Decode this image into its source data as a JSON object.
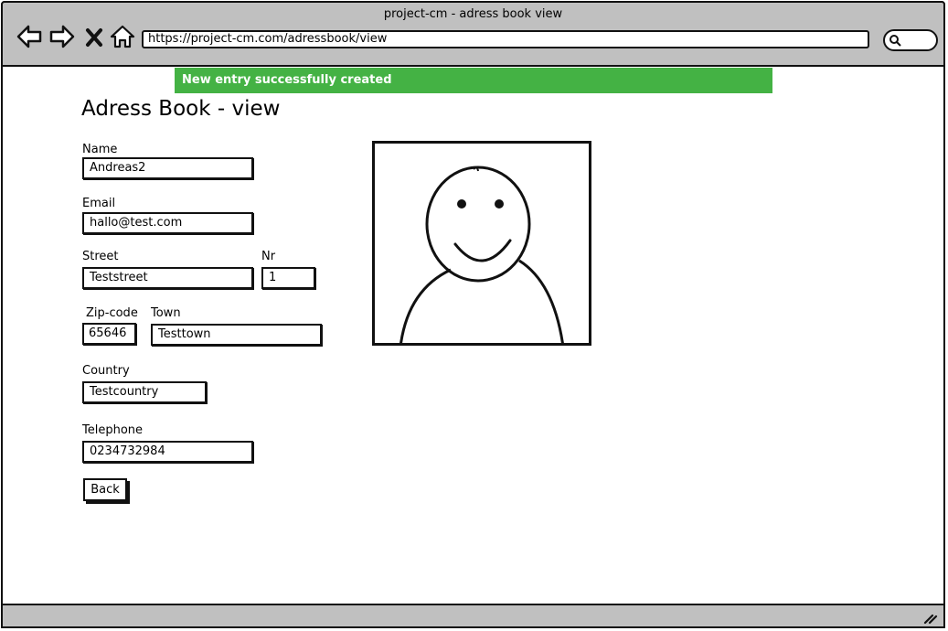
{
  "window": {
    "title": "project-cm - adress book view",
    "url": "https://project-cm.com/adressbook/view"
  },
  "alert": {
    "message": "New entry successfully created",
    "color": "#44b244"
  },
  "page": {
    "title": "Adress Book - view"
  },
  "form": {
    "name": {
      "label": "Name",
      "value": "Andreas2"
    },
    "email": {
      "label": "Email",
      "value": "hallo@test.com"
    },
    "street": {
      "label": "Street",
      "value": "Teststreet"
    },
    "nr": {
      "label": "Nr",
      "value": "1"
    },
    "zip": {
      "label": "Zip-code",
      "value": "65646"
    },
    "town": {
      "label": "Town",
      "value": "Testtown"
    },
    "country": {
      "label": "Country",
      "value": "Testcountry"
    },
    "telephone": {
      "label": "Telephone",
      "value": "0234732984"
    }
  },
  "buttons": {
    "back": "Back"
  },
  "icons": {
    "back": "arrow-left-icon",
    "forward": "arrow-right-icon",
    "stop": "close-icon",
    "home": "home-icon",
    "search": "search-icon",
    "photo": "user-avatar-placeholder"
  }
}
